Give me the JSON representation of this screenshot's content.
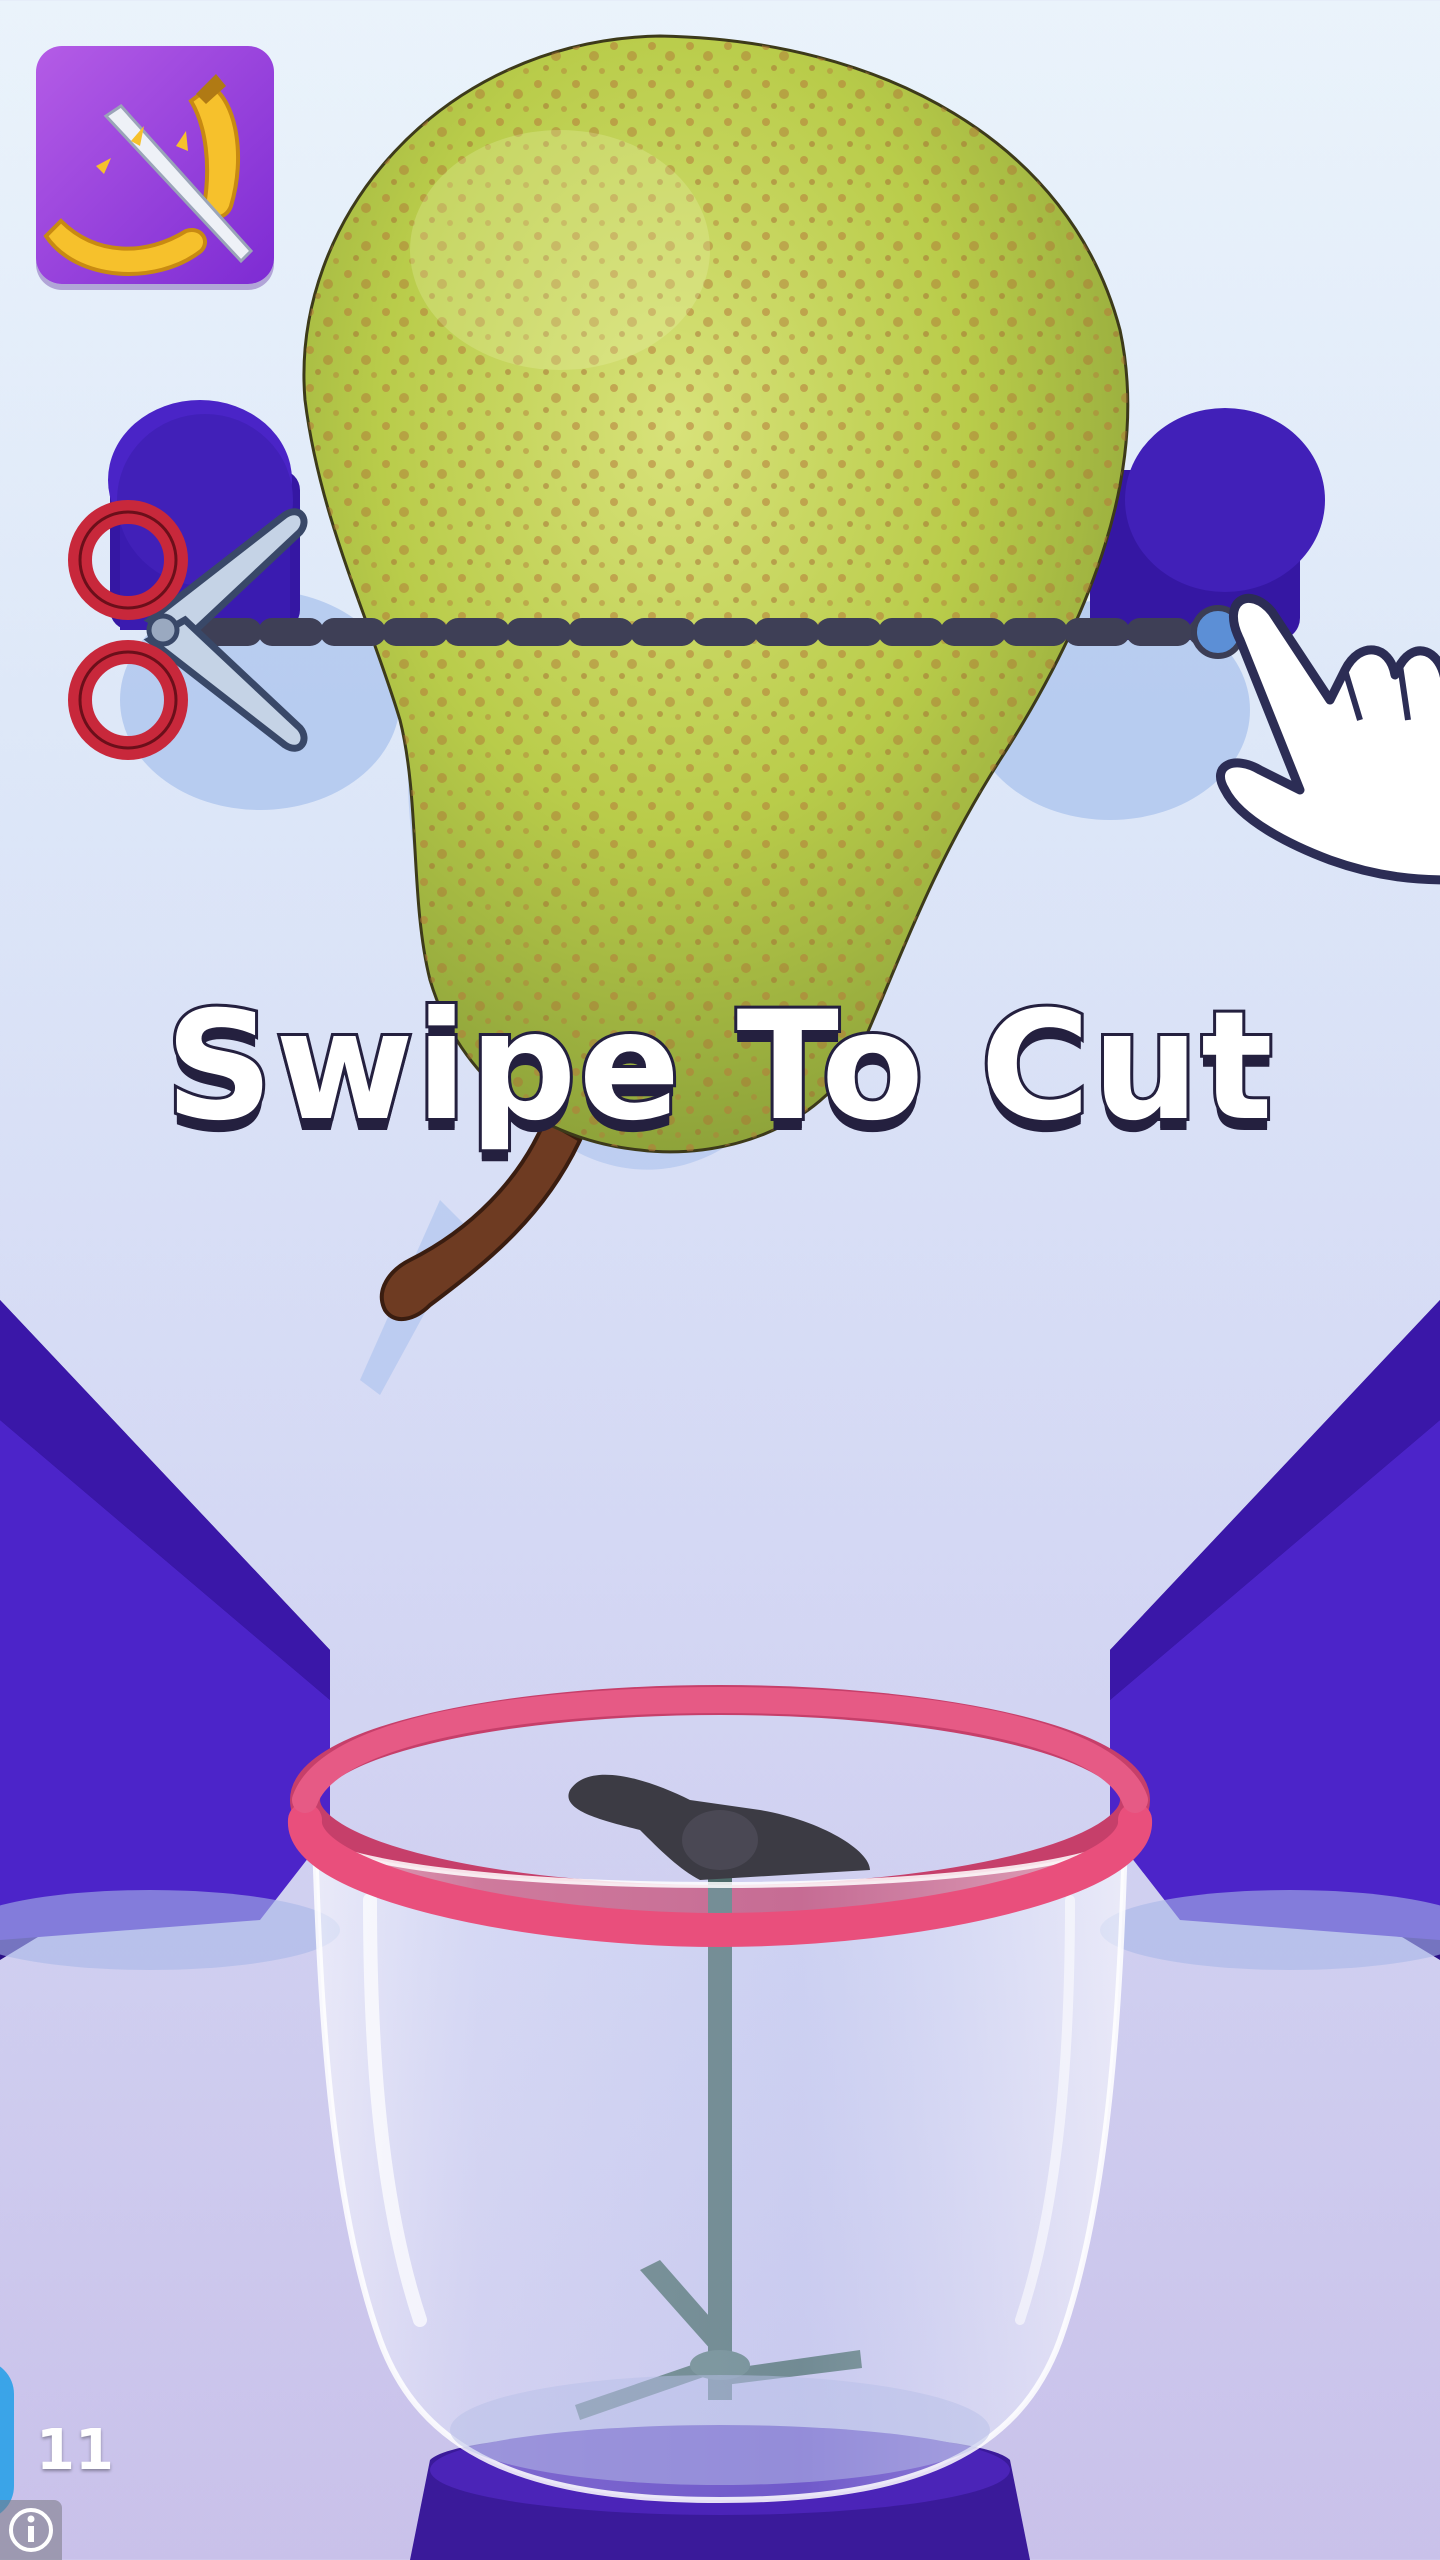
{
  "game": {
    "instruction_text": "Swipe To Cut",
    "level_number": "11"
  },
  "icons": {
    "app_icon": "banana-knife-icon",
    "cut_tool": "scissors-icon",
    "hand_hint": "pointing-hand-icon",
    "info": "info-icon"
  },
  "colors": {
    "accent_purple": "#4a1fb8",
    "blender_rim": "#e94f7c",
    "pear_green": "#b9cc4a"
  }
}
